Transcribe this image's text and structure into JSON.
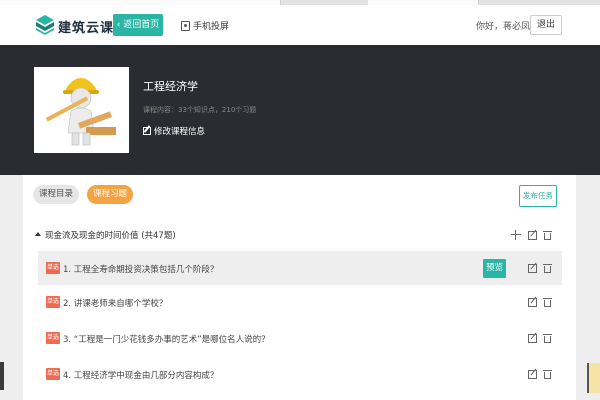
{
  "app": {
    "name": "建筑云课",
    "back_label": "返回首页",
    "cast_label": "手机投屏",
    "greeting": "你好，蒋必凤",
    "logout_label": "退出"
  },
  "course": {
    "title": "工程经济学",
    "meta": "课程内容：33个知识点，210个习题",
    "edit_label": "修改课程信息"
  },
  "tabs": [
    {
      "label": "课程目录",
      "active": false
    },
    {
      "label": "课程习题",
      "active": true
    }
  ],
  "publish_label": "发布任务",
  "section": {
    "title": "现金流及现金的时间价值 (共47题)",
    "questions": [
      {
        "type": "单选",
        "text": "1. 工程全寿命期投资决策包括几个阶段？",
        "preview_label": "预览"
      },
      {
        "type": "单选",
        "text": "2. 讲课老师来自哪个学校？"
      },
      {
        "type": "单选",
        "text": "3. “工程是一门少花钱多办事的艺术”是哪位名人说的？"
      },
      {
        "type": "单选",
        "text": "4. 工程经济学中现金由几部分内容构成？"
      }
    ]
  },
  "colors": {
    "accent": "#2bb5a5",
    "orange": "#f5a243",
    "badge": "#ee6a50",
    "banner": "#2b2c31"
  },
  "icons": [
    "logo-icon",
    "chevron-left-icon",
    "phone-cast-icon",
    "edit-icon",
    "caret-up-icon",
    "plus-icon",
    "trash-icon"
  ]
}
